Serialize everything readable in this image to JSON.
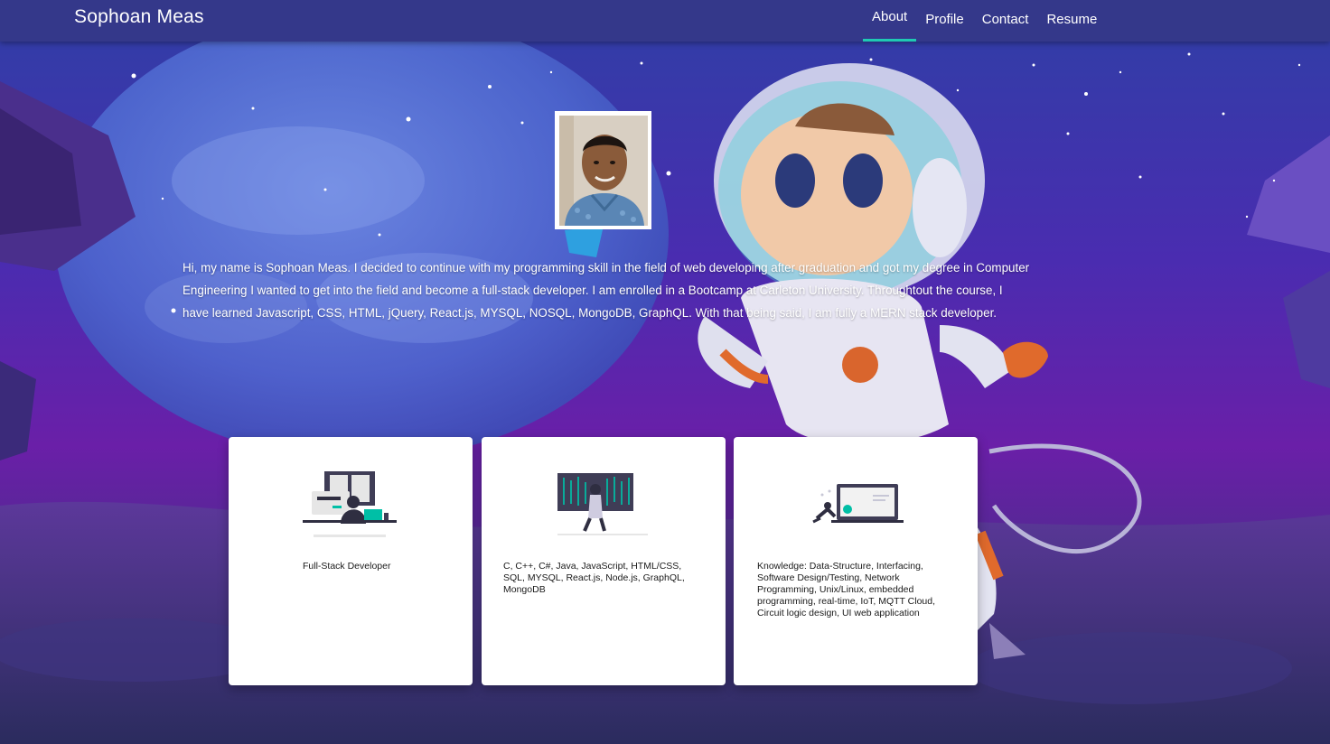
{
  "header": {
    "brand": "Sophoan Meas"
  },
  "nav": [
    {
      "label": "About",
      "active": true
    },
    {
      "label": "Profile",
      "active": false
    },
    {
      "label": "Contact",
      "active": false
    },
    {
      "label": "Resume",
      "active": false
    }
  ],
  "about": {
    "text": "Hi, my name is Sophoan Meas. I decided to continue with my programming skill in the field of web developing after graduation and got my degree in Computer Engineering I wanted to get into the field and become a full-stack developer. I am enrolled in a Bootcamp at Carleton University. Throughtout the course, I have learned Javascript, CSS, HTML, jQuery, React.js, MYSQL, NOSQL, MongoDB, GraphQL. With that being said, I am fully a MERN stack developer."
  },
  "cards": [
    {
      "icon": "developer-desk-illustration",
      "text": "Full-Stack Developer"
    },
    {
      "icon": "matrix-code-illustration",
      "text": "C, C++, C#, Java, JavaScript, HTML/CSS, SQL, MYSQL, React.js, Node.js, GraphQL, MongoDB"
    },
    {
      "icon": "laptop-illustration",
      "text": "Knowledge: Data-Structure, Interfacing, Software Design/Testing, Network Programming, Unix/Linux, embedded programming, real-time, IoT, MQTT Cloud, Circuit logic design, UI web application"
    }
  ],
  "colors": {
    "nav_bg": "#34388a",
    "active_underline": "#1fc9b3",
    "bg_purple": "#5a1fa8",
    "bg_blue": "#3352c9"
  }
}
